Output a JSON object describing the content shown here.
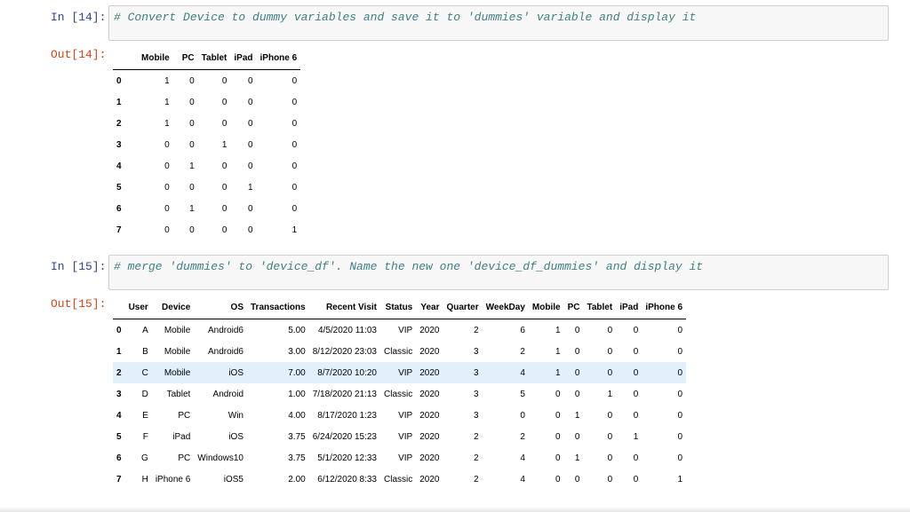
{
  "cell14": {
    "in_prompt": "In [14]:",
    "code": "# Convert Device to dummy variables and save it to 'dummies' variable and display it",
    "out_prompt": "Out[14]:",
    "table": {
      "columns": [
        "",
        "Mobile",
        "PC",
        "Tablet",
        "iPad",
        "iPhone 6"
      ],
      "rows": [
        [
          "0",
          "1",
          "0",
          "0",
          "0",
          "0"
        ],
        [
          "1",
          "1",
          "0",
          "0",
          "0",
          "0"
        ],
        [
          "2",
          "1",
          "0",
          "0",
          "0",
          "0"
        ],
        [
          "3",
          "0",
          "0",
          "1",
          "0",
          "0"
        ],
        [
          "4",
          "0",
          "1",
          "0",
          "0",
          "0"
        ],
        [
          "5",
          "0",
          "0",
          "0",
          "1",
          "0"
        ],
        [
          "6",
          "0",
          "1",
          "0",
          "0",
          "0"
        ],
        [
          "7",
          "0",
          "0",
          "0",
          "0",
          "1"
        ]
      ]
    }
  },
  "cell15": {
    "in_prompt": "In [15]:",
    "code": "# merge 'dummies' to 'device_df'. Name the new one 'device_df_dummies' and display it",
    "out_prompt": "Out[15]:",
    "highlighted_row": 2,
    "table": {
      "columns": [
        "",
        "User",
        "Device",
        "OS",
        "Transactions",
        "Recent Visit",
        "Status",
        "Year",
        "Quarter",
        "WeekDay",
        "Mobile",
        "PC",
        "Tablet",
        "iPad",
        "iPhone 6"
      ],
      "rows": [
        [
          "0",
          "A",
          "Mobile",
          "Android6",
          "5.00",
          "4/5/2020 11:03",
          "VIP",
          "2020",
          "2",
          "6",
          "1",
          "0",
          "0",
          "0",
          "0"
        ],
        [
          "1",
          "B",
          "Mobile",
          "Android6",
          "3.00",
          "8/12/2020 23:03",
          "Classic",
          "2020",
          "3",
          "2",
          "1",
          "0",
          "0",
          "0",
          "0"
        ],
        [
          "2",
          "C",
          "Mobile",
          "iOS",
          "7.00",
          "8/7/2020 10:20",
          "VIP",
          "2020",
          "3",
          "4",
          "1",
          "0",
          "0",
          "0",
          "0"
        ],
        [
          "3",
          "D",
          "Tablet",
          "Android",
          "1.00",
          "7/18/2020 21:13",
          "Classic",
          "2020",
          "3",
          "5",
          "0",
          "0",
          "1",
          "0",
          "0"
        ],
        [
          "4",
          "E",
          "PC",
          "Win",
          "4.00",
          "8/17/2020 1:23",
          "VIP",
          "2020",
          "3",
          "0",
          "0",
          "1",
          "0",
          "0",
          "0"
        ],
        [
          "5",
          "F",
          "iPad",
          "iOS",
          "3.75",
          "6/24/2020 15:23",
          "VIP",
          "2020",
          "2",
          "2",
          "0",
          "0",
          "0",
          "1",
          "0"
        ],
        [
          "6",
          "G",
          "PC",
          "Windows10",
          "3.75",
          "5/1/2020 12:33",
          "VIP",
          "2020",
          "2",
          "4",
          "0",
          "1",
          "0",
          "0",
          "0"
        ],
        [
          "7",
          "H",
          "iPhone 6",
          "iOS5",
          "2.00",
          "6/12/2020 8:33",
          "Classic",
          "2020",
          "2",
          "4",
          "0",
          "0",
          "0",
          "0",
          "1"
        ]
      ]
    }
  }
}
